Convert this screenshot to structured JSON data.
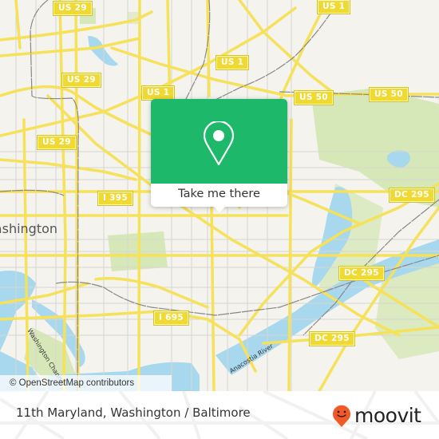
{
  "map": {
    "city_label": "Washington",
    "shields": [
      {
        "label": "US 29",
        "kind": "us"
      },
      {
        "label": "US 29",
        "kind": "us"
      },
      {
        "label": "US 29",
        "kind": "us"
      },
      {
        "label": "US 1",
        "kind": "us"
      },
      {
        "label": "US 1",
        "kind": "us"
      },
      {
        "label": "US 1",
        "kind": "us"
      },
      {
        "label": "US 50",
        "kind": "us"
      },
      {
        "label": "US 50",
        "kind": "us"
      },
      {
        "label": "I 395",
        "kind": "interstate"
      },
      {
        "label": "I 695",
        "kind": "interstate"
      },
      {
        "label": "DC 295",
        "kind": "dc"
      },
      {
        "label": "DC 295",
        "kind": "dc"
      },
      {
        "label": "DC 295",
        "kind": "dc"
      }
    ],
    "water_labels": [
      "Washington Channel",
      "Anacostia River"
    ],
    "colors": {
      "land": "#f4f3ee",
      "road": "#f5e15a",
      "water": "#a8d8ee",
      "park": "#d6e8b8",
      "rail": "#888888"
    }
  },
  "popup": {
    "icon": "location-pin-icon",
    "button_label": "Take me there",
    "color": "#1db86a"
  },
  "attribution": "© OpenStreetMap contributors",
  "footer": {
    "title": "11th Maryland, Washington / Baltimore",
    "brand": "moovit",
    "brand_color": "#f05a28"
  }
}
